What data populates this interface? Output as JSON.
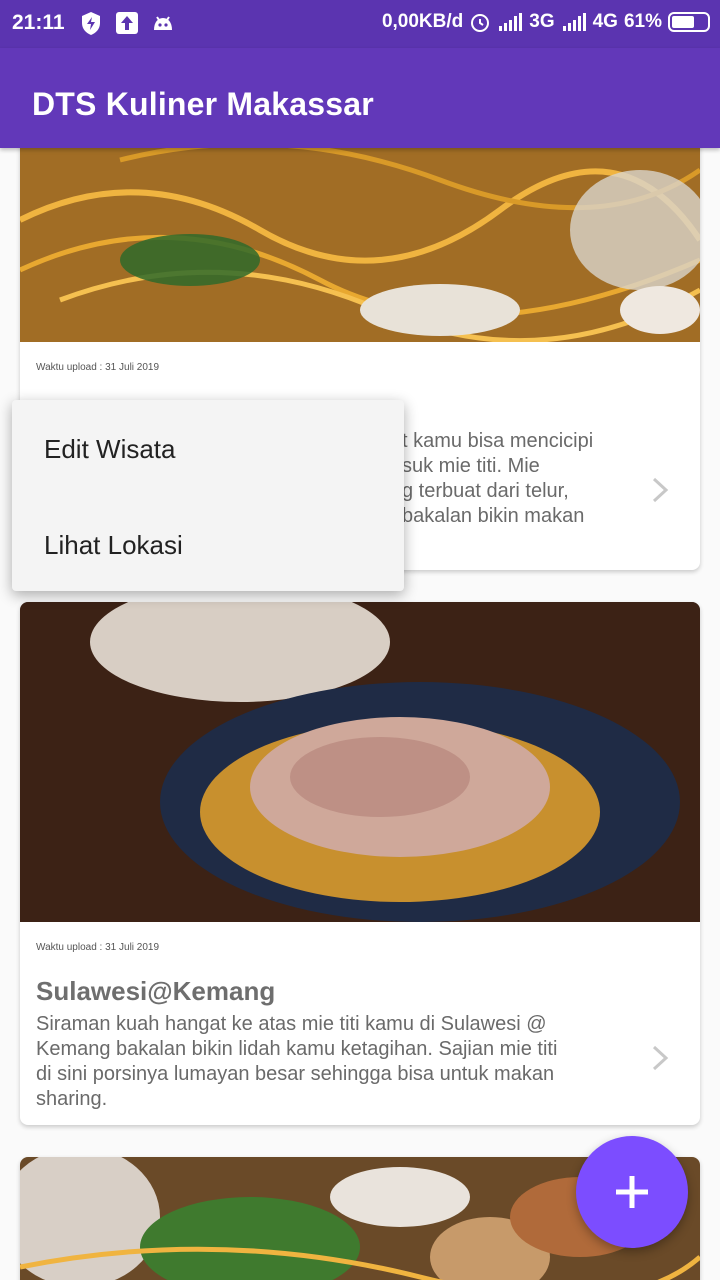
{
  "status_bar": {
    "time": "21:11",
    "network_speed": "0,00KB/d",
    "signal_3g": "3G",
    "signal_4g": "4G",
    "battery": "61%"
  },
  "app_bar": {
    "title": "DTS Kuliner Makassar"
  },
  "cards": [
    {
      "date": "Waktu upload :  31 Juli 2019",
      "title": "",
      "description_lines": [
        "t kamu bisa mencicipi",
        "suk mie titi. Mie",
        "g terbuat dari telur,",
        "bakalan bikin makan"
      ]
    },
    {
      "date": "Waktu upload :  31 Juli 2019",
      "title": "Sulawesi@Kemang",
      "description_lines": [
        "Siraman kuah hangat ke atas mie titi kamu di Sulawesi @",
        "Kemang bakalan bikin lidah kamu ketagihan. Sajian mie titi",
        "di sini porsinya lumayan besar sehingga bisa untuk makan",
        "sharing."
      ]
    }
  ],
  "popup_menu": {
    "items": [
      {
        "label": "Edit Wisata"
      },
      {
        "label": "Lihat Lokasi"
      }
    ]
  },
  "fab": {
    "icon": "plus-icon"
  },
  "colors": {
    "primary": "#6238b9",
    "status_bar": "#5b34b0",
    "accent": "#7c4dff"
  }
}
